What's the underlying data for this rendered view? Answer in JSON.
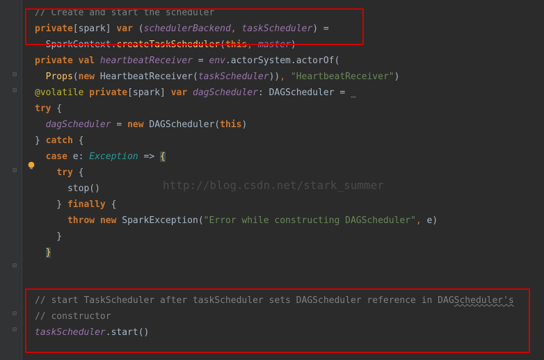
{
  "watermark": "http://blog.csdn.net/stark_summer",
  "code": {
    "l1_cm": "// Create and start the scheduler",
    "l2_kw1": "private",
    "l2_pl1": "[spark] ",
    "l2_kw2": "var",
    "l2_pl2": " (",
    "l2_id1": "schedulerBackend",
    "l2_cm": ",",
    "l2_sp": " ",
    "l2_id2": "taskScheduler",
    "l2_pl3": ") =",
    "l3_pl1": "  SparkContext.",
    "l3_fn": "createTaskScheduler",
    "l3_pl2": "(",
    "l3_kw1": "this",
    "l3_cm": ",",
    "l3_sp": " ",
    "l3_id1": "master",
    "l3_pl3": ")",
    "l4_kw1": "private val",
    "l4_sp": " ",
    "l4_id1": "heartbeatReceiver",
    "l4_pl1": " = ",
    "l4_id2": "env",
    "l4_pl2": ".actorSystem.actorOf(",
    "l5_pl1": "  ",
    "l5_fn1": "Props",
    "l5_pl2": "(",
    "l5_kw1": "new",
    "l5_pl3": " HeartbeatReceiver(",
    "l5_id1": "taskScheduler",
    "l5_pl4": "))",
    "l5_cm": ",",
    "l5_sp": " ",
    "l5_str": "\"HeartbeatReceiver\"",
    "l5_pl5": ")",
    "l6_ann": "@volatile",
    "l6_sp": " ",
    "l6_kw1": "private",
    "l6_pl1": "[spark] ",
    "l6_kw2": "var",
    "l6_sp2": " ",
    "l6_id1": "dagScheduler",
    "l6_pl2": ": DAGScheduler = _",
    "l7_kw": "try",
    "l7_pl": " {",
    "l8_pl1": "  ",
    "l8_id1": "dagScheduler",
    "l8_pl2": " = ",
    "l8_kw": "new",
    "l8_pl3": " DAGScheduler(",
    "l8_kw2": "this",
    "l8_pl4": ")",
    "l9_pl": "} ",
    "l9_kw": "catch",
    "l9_pl2": " {",
    "l10_pl1": "  ",
    "l10_kw": "case",
    "l10_pl2": " e: ",
    "l10_cls": "Exception",
    "l10_pl3": " => ",
    "l10_br": "{",
    "l11_pl1": "    ",
    "l11_kw": "try",
    "l11_pl2": " {",
    "l12_pl1": "      stop()",
    "l13_pl1": "    } ",
    "l13_kw": "finally",
    "l13_pl2": " {",
    "l14_pl1": "      ",
    "l14_kw1": "throw",
    "l14_sp": " ",
    "l14_kw2": "new",
    "l14_pl2": " SparkException(",
    "l14_str": "\"Error while constructing DAGScheduler\"",
    "l14_cm": ",",
    "l14_pl3": " e)",
    "l15_pl": "    }",
    "l16_pl1": "  ",
    "l16_br": "}",
    "l17_blank": " ",
    "l18_blank": " ",
    "l19_cm1": "// start TaskScheduler after taskScheduler sets DAGScheduler reference in DAG",
    "l19_cm2": "Scheduler's",
    "l20_cm": "// constructor",
    "l21_id": "taskScheduler",
    "l21_pl": ".start()"
  }
}
